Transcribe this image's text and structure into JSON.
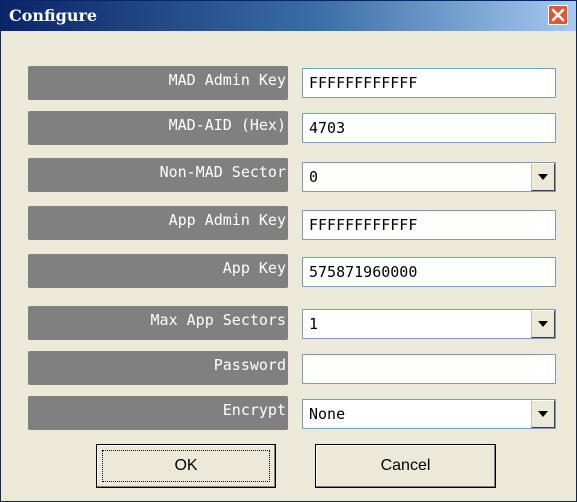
{
  "window": {
    "title": "Configure"
  },
  "fields": [
    {
      "label": "MAD Admin Key",
      "value": "FFFFFFFFFFFF",
      "type": "text"
    },
    {
      "label": "MAD-AID (Hex)",
      "value": "4703",
      "type": "text"
    },
    {
      "label": "Non-MAD Sector",
      "value": "0",
      "type": "select"
    },
    {
      "label": "App Admin Key",
      "value": "FFFFFFFFFFFF",
      "type": "text"
    },
    {
      "label": "App Key",
      "value": "575871960000",
      "type": "text"
    },
    {
      "label": "Max App Sectors",
      "value": "1",
      "type": "select"
    },
    {
      "label": "Password",
      "value": "",
      "type": "password"
    },
    {
      "label": "Encrypt",
      "value": "None",
      "type": "select"
    }
  ],
  "buttons": {
    "ok": "OK",
    "cancel": "Cancel"
  },
  "icons": {
    "close": "close-icon",
    "dropdown": "chevron-down-icon"
  },
  "colors": {
    "title_bar": "#0a246a",
    "dialog_bg": "#ece9d8",
    "label_bg": "#808080",
    "close_button": "#e4572e"
  }
}
